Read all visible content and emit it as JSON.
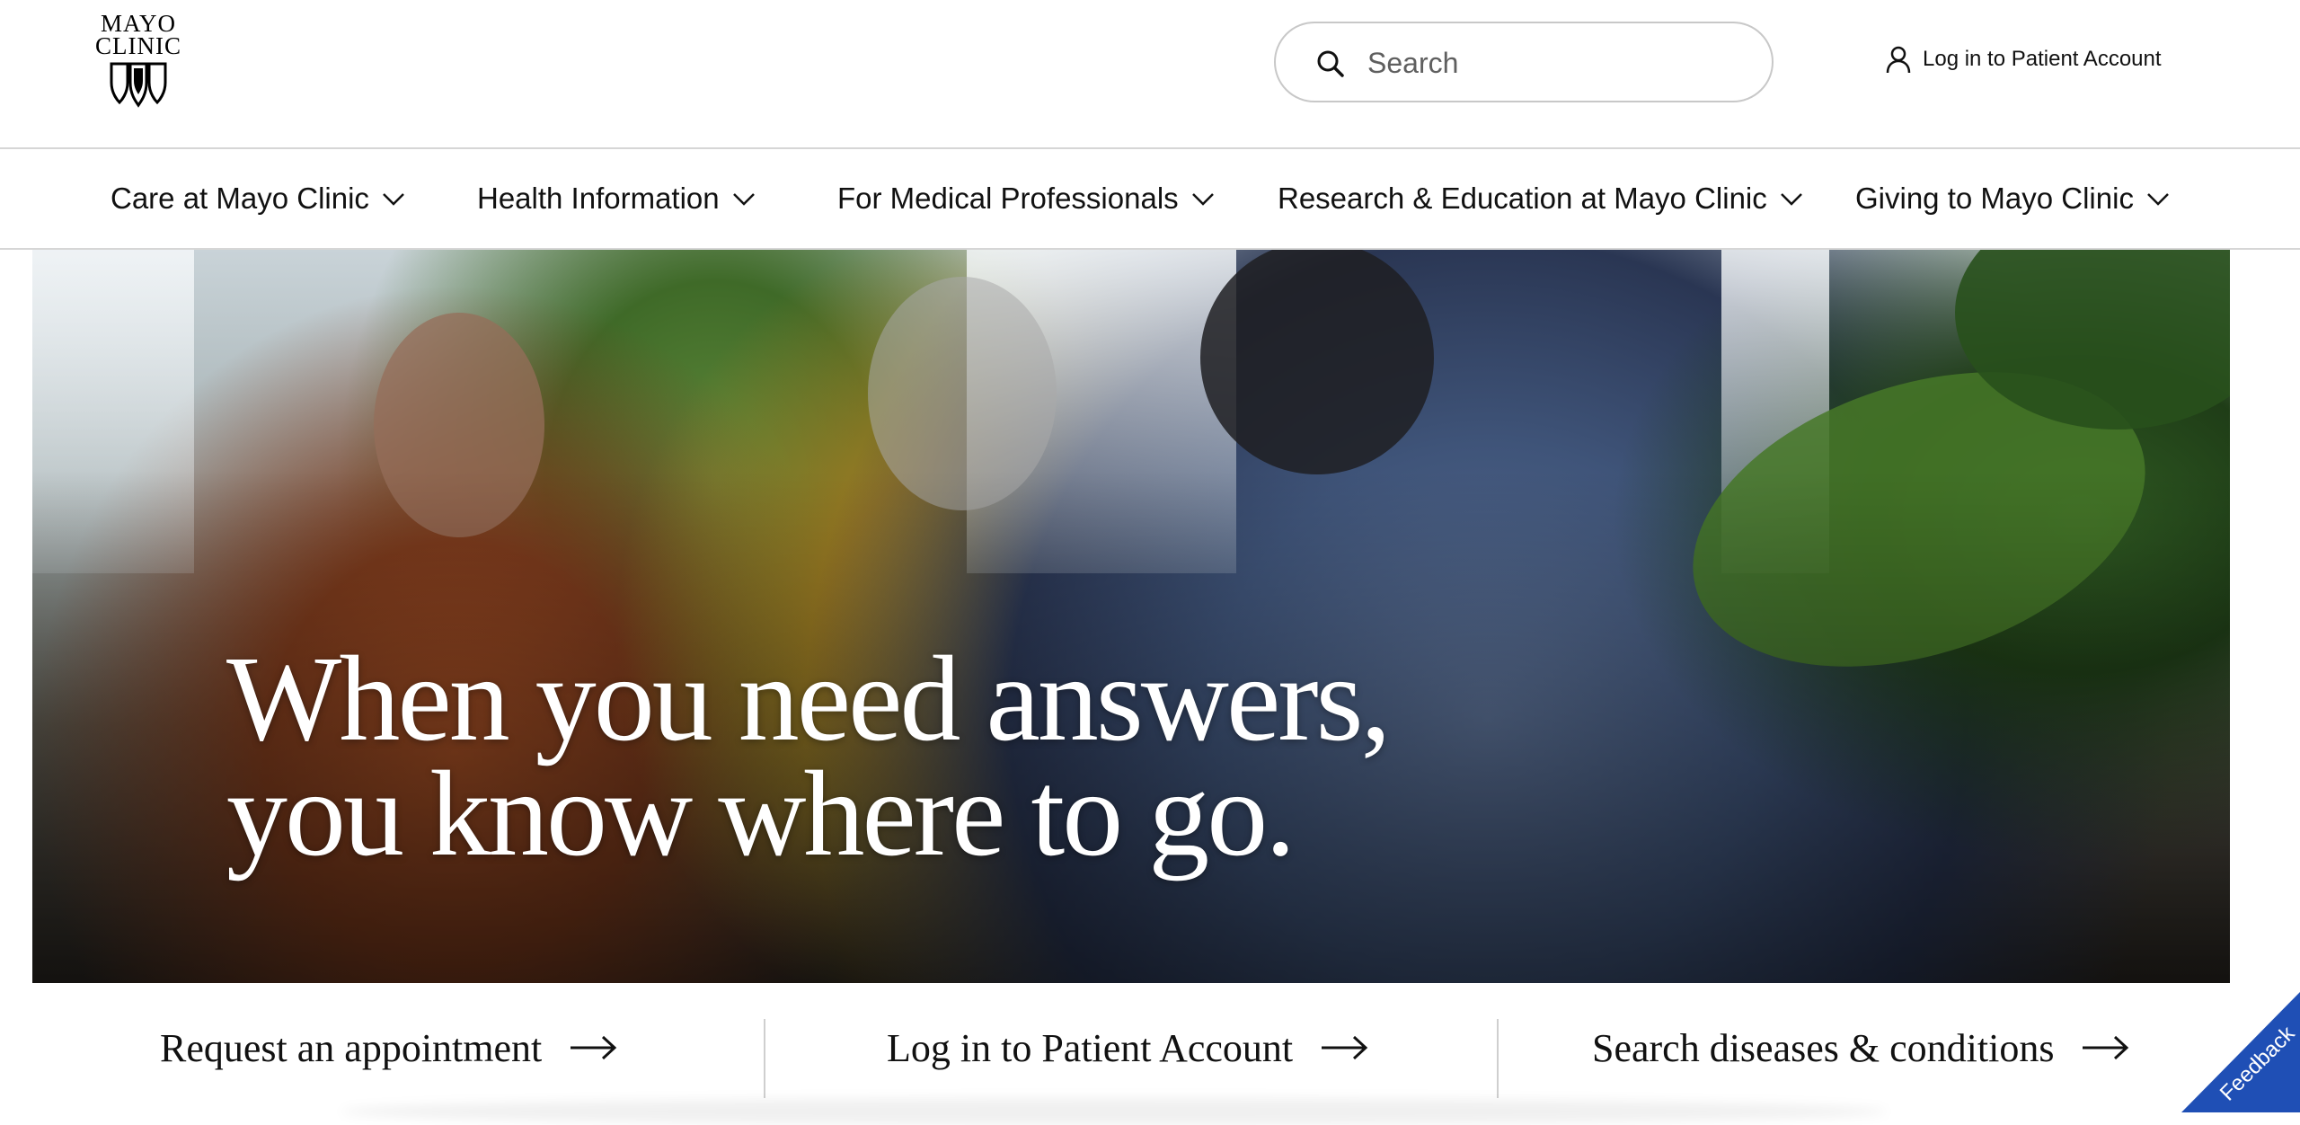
{
  "header": {
    "logo": {
      "line1": "MAYO",
      "line2": "CLINIC"
    },
    "search": {
      "placeholder": "Search",
      "icon": "search-icon"
    },
    "account": {
      "label": "Log in to Patient Account",
      "icon": "user-icon"
    }
  },
  "nav": {
    "items": [
      {
        "label": "Care at Mayo Clinic"
      },
      {
        "label": "Health Information"
      },
      {
        "label": "For Medical Professionals"
      },
      {
        "label": "Research & Education at Mayo Clinic"
      },
      {
        "label": "Giving to Mayo Clinic"
      }
    ],
    "dropdown_icon": "chevron-down-icon"
  },
  "hero": {
    "headline_line1": "When you need answers,",
    "headline_line2": "you know where to go."
  },
  "quick_links": [
    {
      "label": "Request an appointment",
      "icon": "arrow-right-icon"
    },
    {
      "label": "Log in to Patient Account",
      "icon": "arrow-right-icon"
    },
    {
      "label": "Search diseases & conditions",
      "icon": "arrow-right-icon"
    }
  ],
  "feedback": {
    "label": "Feedback",
    "color": "#1f4fb5"
  },
  "colors": {
    "text": "#111111",
    "border": "#d6d6d6",
    "background": "#ffffff"
  }
}
